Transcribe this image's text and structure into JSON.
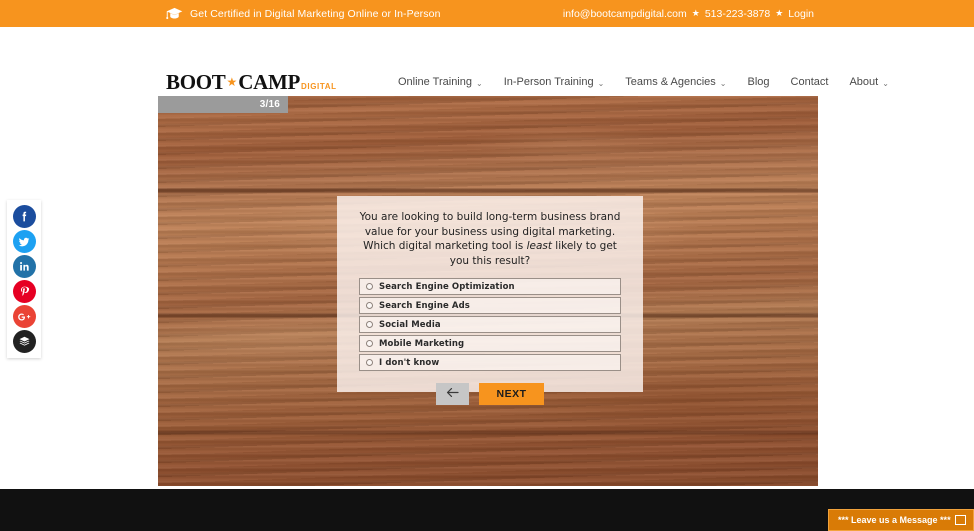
{
  "topbar": {
    "icon": "graduation-cap-icon",
    "tagline": "Get Certified in Digital Marketing Online or In-Person",
    "email": "info@bootcampdigital.com",
    "phone": "513-223-3878",
    "login": "Login",
    "separator": "★",
    "background_color": "#f7941e"
  },
  "header": {
    "logo": {
      "part1": "BOOT",
      "star": "★",
      "part2": "CAMP",
      "sub": "DIGITAL",
      "accent_color": "#f7941e"
    },
    "nav": [
      {
        "label": "Online Training",
        "has_dropdown": true,
        "caret": "⌄"
      },
      {
        "label": "In-Person Training",
        "has_dropdown": true,
        "caret": "⌄"
      },
      {
        "label": "Teams & Agencies",
        "has_dropdown": true,
        "caret": "⌄"
      },
      {
        "label": "Blog",
        "has_dropdown": false,
        "caret": ""
      },
      {
        "label": "Contact",
        "has_dropdown": false,
        "caret": ""
      },
      {
        "label": "About",
        "has_dropdown": true,
        "caret": "⌄"
      }
    ]
  },
  "quiz": {
    "progress": "3/16",
    "current_question": 3,
    "total_questions": 16,
    "question_part1": "You are looking to build long-term business brand value for your business using digital marketing. Which digital marketing tool is ",
    "question_emphasis": "least",
    "question_part2": " likely to get you this result?",
    "options": [
      {
        "label": "Search Engine Optimization",
        "selected": false
      },
      {
        "label": "Search Engine Ads",
        "selected": false
      },
      {
        "label": "Social Media",
        "selected": false
      },
      {
        "label": "Mobile Marketing",
        "selected": false
      },
      {
        "label": "I don't know",
        "selected": false
      }
    ],
    "back_label": "←",
    "next_label": "NEXT",
    "next_color": "#f7941e",
    "back_color": "#c6c6c6"
  },
  "social_rail": [
    {
      "name": "facebook",
      "glyph": "f",
      "color": "#1b4d9e"
    },
    {
      "name": "twitter",
      "glyph": "t",
      "color": "#1da1f2"
    },
    {
      "name": "linkedin",
      "glyph": "in",
      "color": "#2272a8"
    },
    {
      "name": "pinterest",
      "glyph": "P",
      "color": "#e60023"
    },
    {
      "name": "googleplus",
      "glyph": "G+",
      "color": "#ea4335"
    },
    {
      "name": "buffer",
      "glyph": "≡",
      "color": "#222222"
    }
  ],
  "chat": {
    "label": "*** Leave us a Message ***",
    "background_color": "#d97b06"
  },
  "footer": {
    "background_color": "#111111"
  }
}
